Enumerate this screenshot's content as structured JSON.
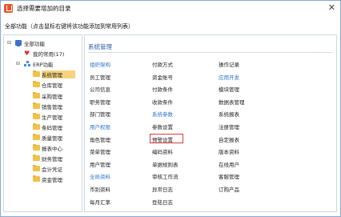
{
  "window": {
    "title": "选择需要增加的目录",
    "close_glyph": "✕"
  },
  "subtitle": "全部功能（点击鼠标右键将该功能添加到常用列表）",
  "tree": [
    {
      "toggle": "⊟",
      "icon": "monitor-icon",
      "label": "全部功能"
    },
    {
      "toggle": "",
      "icon": "heart-icon",
      "label": "我的常用(17)"
    },
    {
      "toggle": "⊟",
      "icon": "sitemap-icon",
      "label": "ERP功能"
    },
    {
      "toggle": "",
      "icon": "folder-icon",
      "label": "系统管理",
      "selected": true
    },
    {
      "toggle": "",
      "icon": "folder-icon",
      "label": "仓库管理"
    },
    {
      "toggle": "",
      "icon": "folder-icon",
      "label": "采购管理"
    },
    {
      "toggle": "",
      "icon": "folder-icon",
      "label": "销售管理"
    },
    {
      "toggle": "",
      "icon": "folder-icon",
      "label": "生产管理"
    },
    {
      "toggle": "",
      "icon": "folder-icon",
      "label": "条码管理"
    },
    {
      "toggle": "",
      "icon": "folder-icon",
      "label": "质量管理"
    },
    {
      "toggle": "",
      "icon": "folder-icon",
      "label": "报表中心"
    },
    {
      "toggle": "",
      "icon": "folder-icon",
      "label": "财务管理"
    },
    {
      "toggle": "",
      "icon": "folder-icon",
      "label": "会计凭证"
    },
    {
      "toggle": "",
      "icon": "folder-icon",
      "label": "资金管理"
    }
  ],
  "main": {
    "title": "系统管理",
    "col1": [
      {
        "kind": "section",
        "text": "组织架构"
      },
      {
        "kind": "item",
        "text": "员工管理"
      },
      {
        "kind": "item",
        "text": "公司信息"
      },
      {
        "kind": "item",
        "text": "职务管理"
      },
      {
        "kind": "item",
        "text": "部门管理"
      },
      {
        "kind": "section",
        "text": "用户权限"
      },
      {
        "kind": "item",
        "text": "角色管理"
      },
      {
        "kind": "item",
        "text": "菜单管理"
      },
      {
        "kind": "item",
        "text": "用户管理"
      },
      {
        "kind": "section",
        "text": "全局资料"
      },
      {
        "kind": "item",
        "text": "币别资料"
      },
      {
        "kind": "item",
        "text": "每月汇率"
      }
    ],
    "col2": [
      {
        "kind": "item",
        "text": "付款方式"
      },
      {
        "kind": "item",
        "text": "资金账号"
      },
      {
        "kind": "item",
        "text": "付款条件"
      },
      {
        "kind": "item",
        "text": "收款条件"
      },
      {
        "kind": "section",
        "text": "系统参数"
      },
      {
        "kind": "item",
        "text": "参数设置"
      },
      {
        "kind": "item",
        "text": "预警设置",
        "highlighted": true
      },
      {
        "kind": "item",
        "text": "编码资料"
      },
      {
        "kind": "item",
        "text": "单据规则表"
      },
      {
        "kind": "item",
        "text": "审核工作流"
      },
      {
        "kind": "item",
        "text": "异常日志"
      },
      {
        "kind": "item",
        "text": "登陆日志"
      }
    ],
    "col3": [
      {
        "kind": "item",
        "text": "操作记录"
      },
      {
        "kind": "section",
        "text": "应用开发"
      },
      {
        "kind": "item",
        "text": "模块管理"
      },
      {
        "kind": "item",
        "text": "数据表管理"
      },
      {
        "kind": "item",
        "text": "系统报表"
      },
      {
        "kind": "item",
        "text": "注册管理"
      },
      {
        "kind": "item",
        "text": "自定报表"
      },
      {
        "kind": "item",
        "text": "版本资料"
      },
      {
        "kind": "item",
        "text": "在线用户"
      },
      {
        "kind": "item",
        "text": "客服管理"
      },
      {
        "kind": "item",
        "text": "订购产品"
      }
    ]
  },
  "colors": {
    "section": "#2c75c8",
    "title": "#2c5ea8",
    "selected_row": "#f7d37e",
    "highlight_border": "#e03a3a"
  }
}
